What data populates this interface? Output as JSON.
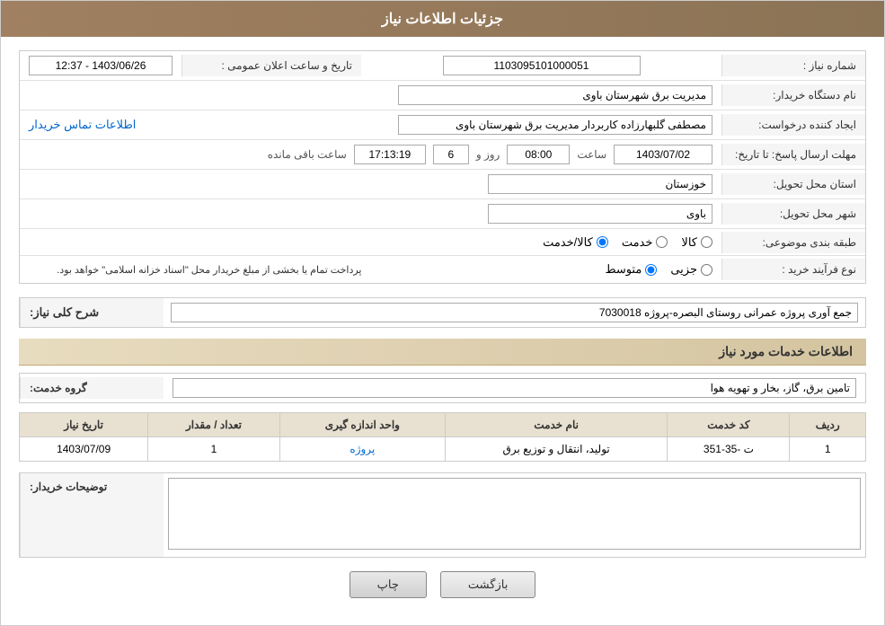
{
  "header": {
    "title": "جزئیات اطلاعات نیاز"
  },
  "fields": {
    "shomareNiaz_label": "شماره نیاز :",
    "shomareNiaz_value": "1103095101000051",
    "namDastgah_label": "نام دستگاه خریدار:",
    "namDastgah_value": "مدیریت برق شهرستان باوی",
    "ijadKonnande_label": "ایجاد کننده درخواست:",
    "ijadKonnande_value": "مصطفی گلبهارزاده کاربردار مدیریت برق شهرستان باوی",
    "ettelaatTamas_label": "اطلاعات تماس خریدار",
    "mohlat_label": "مهلت ارسال پاسخ: تا تاریخ:",
    "date_value": "1403/07/02",
    "saat_label": "ساعت",
    "saat_value": "08:00",
    "roz_label": "روز و",
    "roz_value": "6",
    "baghimande_label": "ساعت باقی مانده",
    "baghimande_value": "17:13:19",
    "tarikh_elaan_label": "تاریخ و ساعت اعلان عمومی :",
    "tarikh_elaan_value": "1403/06/26 - 12:37",
    "ostan_label": "استان محل تحویل:",
    "ostan_value": "خوزستان",
    "shahr_label": "شهر محل تحویل:",
    "shahr_value": "باوی",
    "tabaqe_label": "طبقه بندی موضوعی:",
    "kala_label": "کالا",
    "khadamat_label": "خدمت",
    "kalaKhadamat_label": "کالا/خدمت",
    "noefarayand_label": "نوع فرآیند خرید :",
    "jozee_label": "جزیی",
    "motaset_label": "متوسط",
    "notice_text": "پرداخت تمام یا بخشی از مبلغ خریدار محل \"اسناد خزانه اسلامی\" خواهد بود.",
    "sharh_label": "شرح کلی نیاز:",
    "sharh_value": "جمع آوری پروژه عمرانی روستای البصره-پروژه 7030018",
    "khadamat_mored_label": "اطلاعات خدمات مورد نیاز",
    "grohe_label": "گروه خدمت:",
    "grohe_value": "تامین برق، گاز، بخار و تهویه هوا",
    "table": {
      "headers": [
        "ردیف",
        "کد خدمت",
        "نام خدمت",
        "واحد اندازه گیری",
        "تعداد / مقدار",
        "تاریخ نیاز"
      ],
      "rows": [
        [
          "1",
          "ت -35-351",
          "تولید، انتقال و توزیع برق",
          "پروژه",
          "1",
          "1403/07/09"
        ]
      ]
    },
    "tozihat_label": "توضیحات خریدار:",
    "tozihat_value": "",
    "btn_print": "چاپ",
    "btn_back": "بازگشت"
  }
}
